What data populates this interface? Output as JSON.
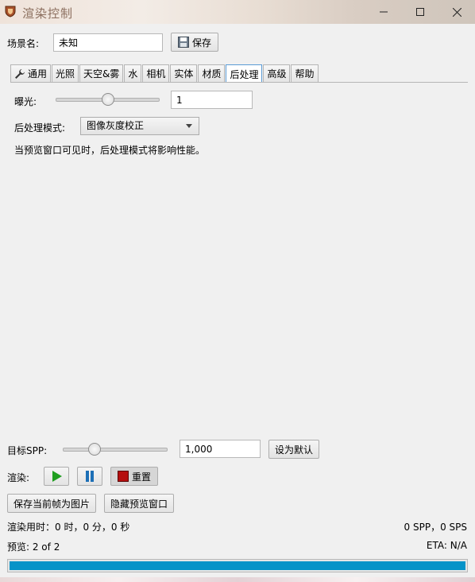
{
  "window": {
    "title": "渲染控制"
  },
  "scene": {
    "name_label": "场景名:",
    "name_value": "未知",
    "save_label": "保存"
  },
  "tabs": [
    {
      "label": "通用",
      "icon": "wrench-icon"
    },
    {
      "label": "光照"
    },
    {
      "label": "天空&雾"
    },
    {
      "label": "水"
    },
    {
      "label": "相机"
    },
    {
      "label": "实体"
    },
    {
      "label": "材质"
    },
    {
      "label": "后处理",
      "active": true
    },
    {
      "label": "高级"
    },
    {
      "label": "帮助"
    }
  ],
  "postprocess": {
    "exposure_label": "曝光:",
    "exposure_value": "1",
    "exposure_slider": 0.5,
    "mode_label": "后处理模式:",
    "mode_value": "图像灰度校正",
    "notice": "当预览窗口可见时，后处理模式将影响性能。"
  },
  "render": {
    "target_spp_label": "目标SPP:",
    "target_spp_value": "1,000",
    "target_spp_slider": 0.3,
    "set_default_label": "设为默认",
    "render_label": "渲染:",
    "reset_label": "重置",
    "save_frame_label": "保存当前帧为图片",
    "hide_preview_label": "隐藏预览窗口",
    "time_text": "渲染用时：0 时，0 分，0 秒",
    "spp_sps_text": "0 SPP，0 SPS",
    "preview_text": "预览: 2 of 2",
    "eta_text": "ETA: N/A",
    "progress": 1.0,
    "progress_color": "#0693c8",
    "play_color": "#1f9e1f",
    "pause_color": "#1c6fb6",
    "reset_color": "#b50f0f"
  }
}
